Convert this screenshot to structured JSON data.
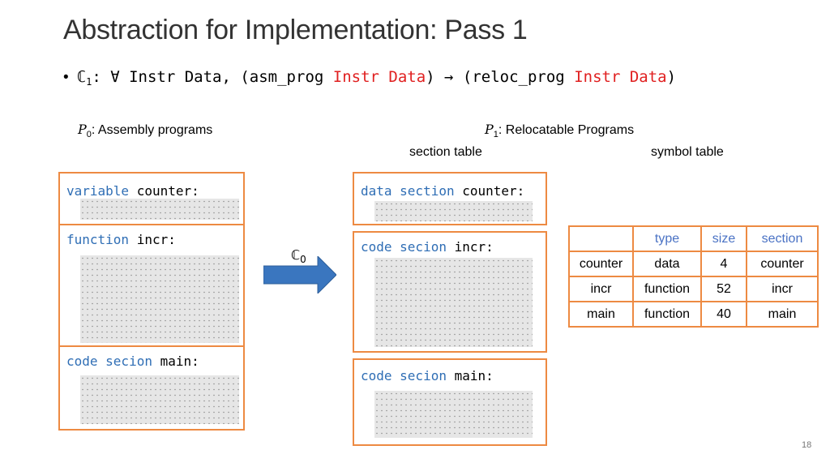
{
  "slide": {
    "title": "Abstraction for Implementation: Pass 1",
    "page_number": "18"
  },
  "bullet": {
    "marker": "•",
    "compiler_symbol": "ℂ",
    "compiler_index": "1",
    "part1": ": ∀ Instr Data, (asm_prog ",
    "red1": "Instr Data",
    "part2": ") → (reloc_prog ",
    "red2": "Instr Data",
    "part3": ")"
  },
  "left_panel": {
    "heading_symbol": "P",
    "heading_index": "0",
    "heading_text": ": Assembly programs",
    "blocks": [
      {
        "keyword": "variable",
        "name": " counter:"
      },
      {
        "keyword": "function",
        "name": " incr:"
      },
      {
        "keyword": "code secion",
        "name": " main:"
      }
    ]
  },
  "arrow": {
    "symbol": "ℂ",
    "index": "0",
    "color": "#3a76bf"
  },
  "right_panel": {
    "heading_symbol": "P",
    "heading_index": "1",
    "heading_text": ": Relocatable Programs",
    "section_table_label": "section table",
    "symbol_table_label": "symbol table",
    "blocks": [
      {
        "keyword": "data section",
        "name": " counter:"
      },
      {
        "keyword": "code secion",
        "name": " incr:"
      },
      {
        "keyword": "code secion",
        "name": " main:"
      }
    ]
  },
  "symbol_table": {
    "headers": [
      "",
      "type",
      "size",
      "section"
    ],
    "rows": [
      [
        "counter",
        "data",
        "4",
        "counter"
      ],
      [
        "incr",
        "function",
        "52",
        "incr"
      ],
      [
        "main",
        "function",
        "40",
        "main"
      ]
    ]
  },
  "colors": {
    "box_border": "#ed8a42",
    "keyword": "#2f6eb5",
    "highlight_red": "#e02020",
    "table_header": "#4a72c4"
  }
}
